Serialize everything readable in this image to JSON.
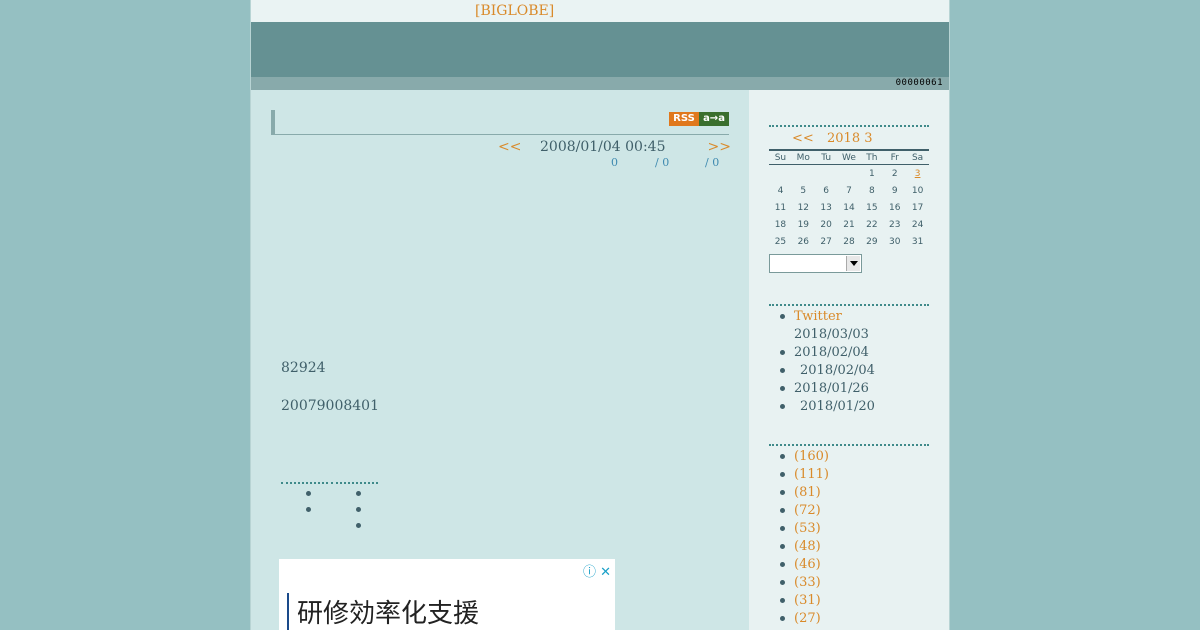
{
  "header": {
    "site_link": "[BIGLOBE]",
    "counter": "00000061"
  },
  "entry": {
    "rss_left": "RSS",
    "rss_right": "a→a",
    "nav_prev": "<<",
    "date": "2008/01/04 00:45",
    "nav_next": ">>",
    "meta": [
      "0",
      "/ 0",
      "/ 0"
    ],
    "lines": [
      "82924",
      "20079008401"
    ]
  },
  "ad": {
    "info_icon": "ⓘ",
    "close_icon": "✕",
    "text": "研修効率化支援"
  },
  "calendar": {
    "prev": "<<",
    "month": "2018 3",
    "weekdays": [
      "Su",
      "Mo",
      "Tu",
      "We",
      "Th",
      "Fr",
      "Sa"
    ],
    "weeks": [
      [
        "",
        "",
        "",
        "",
        "1",
        "2",
        "3"
      ],
      [
        "4",
        "5",
        "6",
        "7",
        "8",
        "9",
        "10"
      ],
      [
        "11",
        "12",
        "13",
        "14",
        "15",
        "16",
        "17"
      ],
      [
        "18",
        "19",
        "20",
        "21",
        "22",
        "23",
        "24"
      ],
      [
        "25",
        "26",
        "27",
        "28",
        "29",
        "30",
        "31"
      ]
    ],
    "today": "3",
    "select_value": ""
  },
  "recent": [
    {
      "title": "Twitter",
      "date": "2018/03/03"
    },
    {
      "title": "",
      "date": "2018/02/04"
    },
    {
      "title": "",
      "date": "2018/02/04"
    },
    {
      "title": "",
      "date": "2018/01/26"
    },
    {
      "title": "",
      "date": "2018/01/20"
    }
  ],
  "categories": [
    "(160)",
    "(111)",
    "(81)",
    "(72)",
    "(53)",
    "(48)",
    "(46)",
    "(33)",
    "(31)",
    "(27)"
  ],
  "colors": {
    "accent": "#d98a2a",
    "text": "#40606a",
    "banner": "#659193",
    "page_bg": "#cee6e6",
    "outer_bg": "#95c0c2"
  }
}
